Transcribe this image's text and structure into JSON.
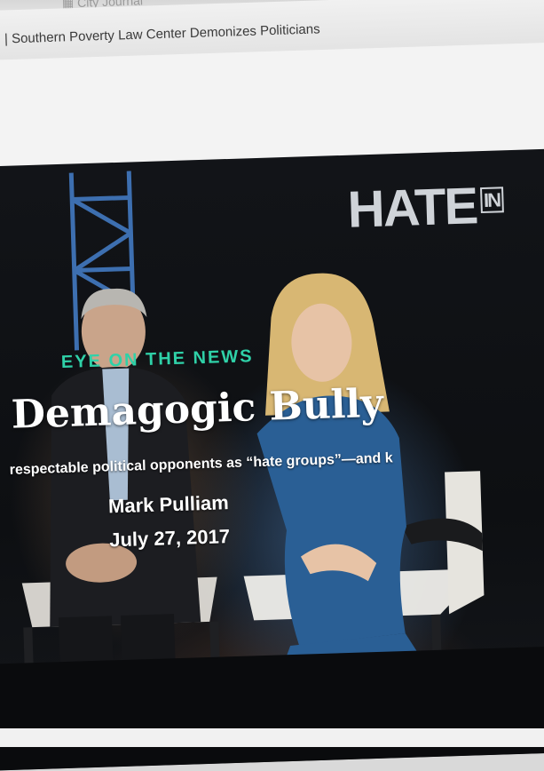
{
  "browser": {
    "tab_ghost": "▦ City Journal",
    "title": "| Southern Poverty Law Center Demonizes Politicians"
  },
  "hero": {
    "logo_word": "HATE",
    "logo_in": "IN",
    "kicker": "EYE ON THE NEWS",
    "headline": "Demagogic Bully",
    "dek": "respectable political opponents as “hate groups”—and k",
    "author": "Mark Pulliam",
    "date": "July 27, 2017"
  },
  "colors": {
    "kicker": "#2fd1a8",
    "hero_bg": "#101216",
    "dress": "#2a5f95"
  }
}
